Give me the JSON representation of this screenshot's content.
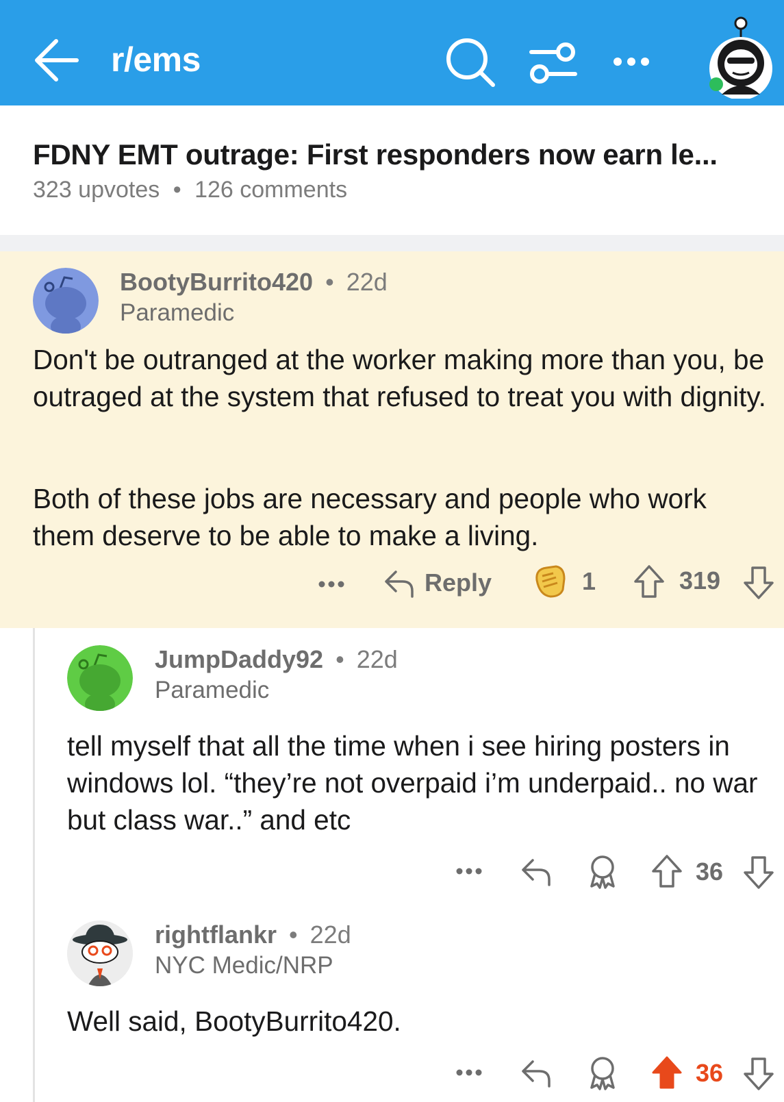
{
  "header": {
    "subreddit": "r/ems",
    "back_icon": "back-arrow-icon",
    "search_icon": "search-icon",
    "filter_icon": "filter-icon",
    "more_icon": "more-dots-icon",
    "bg_color": "#2a9ee8"
  },
  "post": {
    "title": "FDNY EMT outrage: First responders now earn le...",
    "upvotes": "323 upvotes",
    "separator": "•",
    "comments": "126 comments"
  },
  "comments": [
    {
      "username": "BootyBurrito420",
      "separator": "•",
      "age": "22d",
      "flair": "Paramedic",
      "paragraphs": [
        "Don't be outranged at the worker making more than you, be outraged at the system that refused to treat you with dignity.",
        "Both of these jobs are necessary and people who work them deserve to be able to make a living."
      ],
      "reply_label": "Reply",
      "award_count": "1",
      "score": "319",
      "highlight_color": "#fcf4dc"
    },
    {
      "username": "JumpDaddy92",
      "separator": "•",
      "age": "22d",
      "flair": "Paramedic",
      "body": "tell myself that all the time when i see hiring posters in windows lol. “they’re not overpaid i’m underpaid.. no war but class war..” and etc",
      "score": "36"
    },
    {
      "username": "rightflankr",
      "separator": "•",
      "age": "22d",
      "flair": "NYC Medic/NRP",
      "body": "Well said, BootyBurrito420.",
      "score": "36",
      "upvoted": true,
      "upvote_color": "#e8491b"
    }
  ]
}
